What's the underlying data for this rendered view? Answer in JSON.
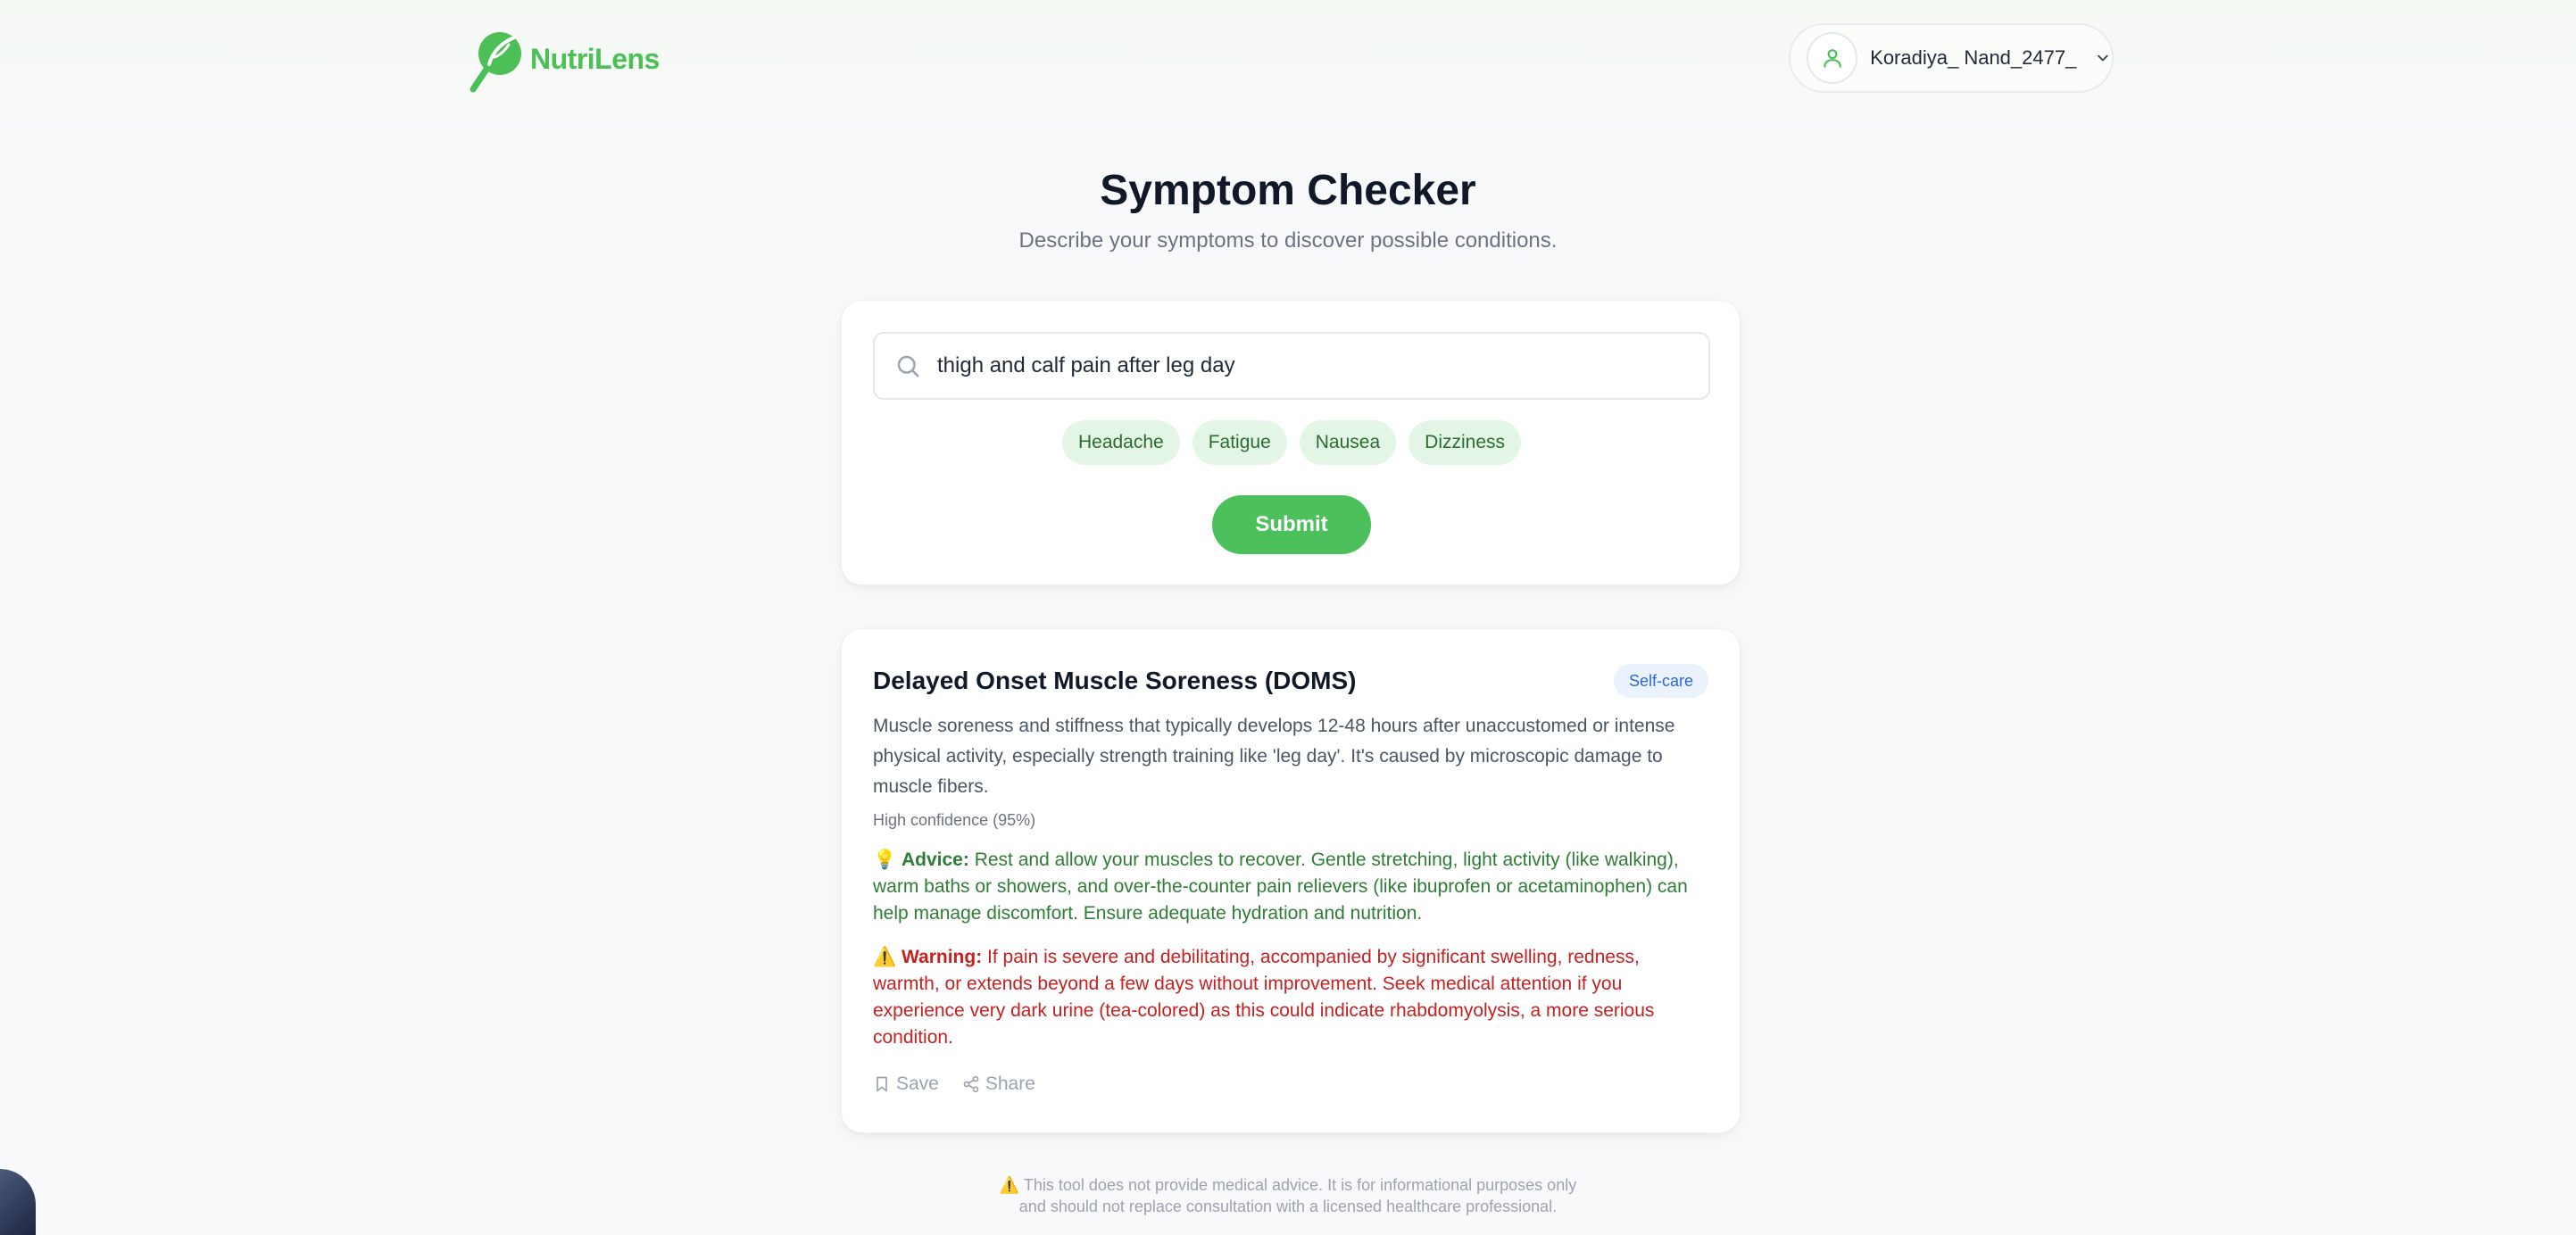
{
  "brand": {
    "name": "NutriLens"
  },
  "user": {
    "name": "Koradiya_ Nand_2477_"
  },
  "page": {
    "title": "Symptom Checker",
    "subtitle": "Describe your symptoms to discover possible conditions."
  },
  "search": {
    "value": "thigh and calf pain after leg day",
    "chips": [
      "Headache",
      "Fatigue",
      "Nausea",
      "Dizziness"
    ],
    "submit_label": "Submit"
  },
  "result": {
    "title": "Delayed Onset Muscle Soreness (DOMS)",
    "badge": "Self-care",
    "description": "Muscle soreness and stiffness that typically develops 12-48 hours after unaccustomed or intense physical activity, especially strength training like 'leg day'. It's caused by microscopic damage to muscle fibers.",
    "confidence": "High confidence (95%)",
    "advice_icon": "💡",
    "advice_label": "Advice:",
    "advice_text": " Rest and allow your muscles to recover. Gentle stretching, light activity (like walking), warm baths or showers, and over-the-counter pain relievers (like ibuprofen or acetaminophen) can help manage discomfort. Ensure adequate hydration and nutrition.",
    "warning_icon": "⚠️",
    "warning_label": "Warning:",
    "warning_text": " If pain is severe and debilitating, accompanied by significant swelling, redness, warmth, or extends beyond a few days without improvement. Seek medical attention if you experience very dark urine (tea-colored) as this could indicate rhabdomyolysis, a more serious condition.",
    "save_label": "Save",
    "share_label": "Share"
  },
  "footer": {
    "disclaimer_icon": "⚠️",
    "disclaimer_line1": "This tool does not provide medical advice. It is for informational purposes only",
    "disclaimer_line2": "and should not replace consultation with a licensed healthcare professional."
  },
  "colors": {
    "brand_green": "#4cbf56",
    "submit_green": "#4cc05a",
    "chip_bg": "#e3f6e5",
    "advice_green": "#2e7d36",
    "warning_red": "#c62020",
    "badge_blue": "#2f66d6"
  },
  "icons": {
    "logo": "leaf-magnifier-icon",
    "avatar": "user-icon",
    "dropdown": "chevron-down-icon",
    "search": "search-icon",
    "save": "bookmark-icon",
    "share": "share-icon"
  }
}
